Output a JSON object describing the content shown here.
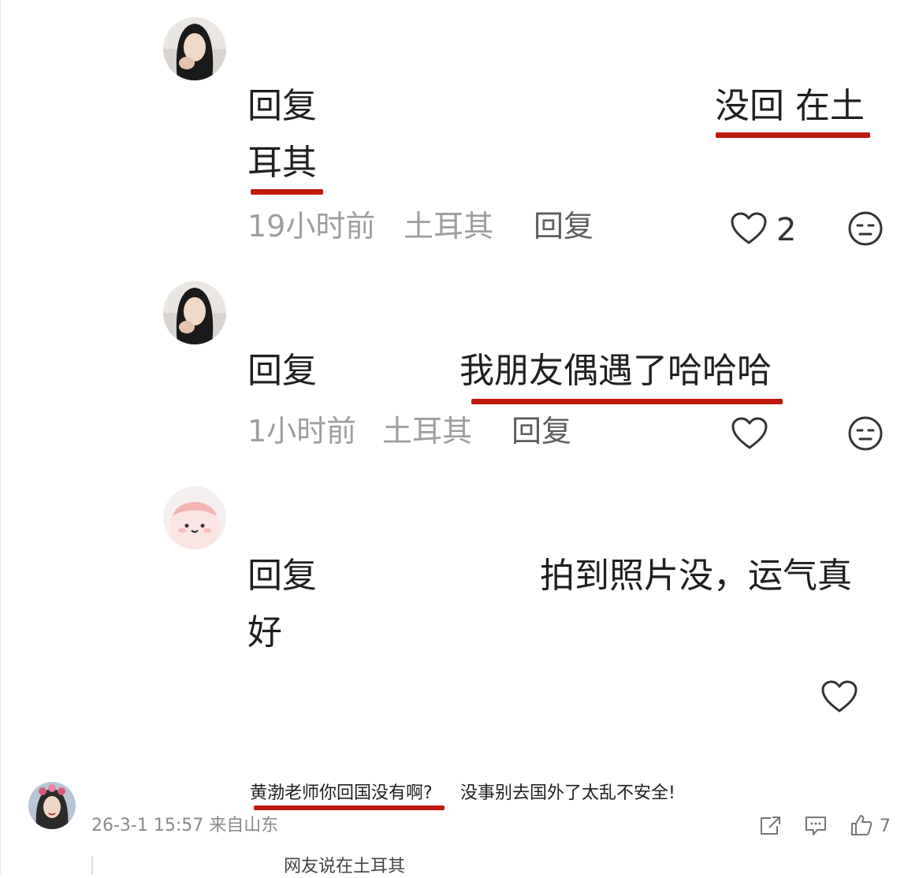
{
  "colors": {
    "accent_underline": "#c0190f",
    "meta_text": "#9e9e9e",
    "primary_text": "#1f1f1f"
  },
  "comments": [
    {
      "reply_prefix": "回复",
      "text_part1": "没回 在土",
      "text_part2": "耳其",
      "time": "19小时前",
      "location": "土耳其",
      "reply_label": "回复",
      "like_icon": "heart-outline-icon",
      "like_count": "2",
      "face_icon": "neutral-face-icon"
    },
    {
      "reply_prefix": "回复",
      "text": "我朋友偶遇了哈哈哈",
      "time": "1小时前",
      "location": "土耳其",
      "reply_label": "回复",
      "like_icon": "heart-outline-icon",
      "face_icon": "neutral-face-icon"
    },
    {
      "reply_prefix": "回复",
      "text_part1": "拍到照片没，运气真",
      "text_part2": "好",
      "like_icon": "heart-outline-icon"
    }
  ],
  "bottom_post": {
    "text_underlined": "黄渤老师你回国没有啊?",
    "text_rest": "没事别去国外了太乱不安全!",
    "timestamp": "26-3-1 15:57 来自山东",
    "share_icon": "share-icon",
    "comment_icon": "comment-icon",
    "like_icon": "thumbs-up-icon",
    "like_count": "7"
  },
  "bottom_reply_preview": "网友说在土耳其"
}
